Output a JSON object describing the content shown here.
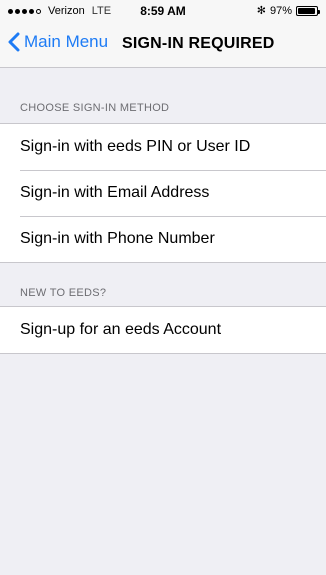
{
  "status_bar": {
    "carrier": "Verizon",
    "network": "LTE",
    "time": "8:59 AM",
    "bluetooth": "✻",
    "battery_percent": "97%",
    "battery_level": 0.97
  },
  "nav": {
    "back_label": "Main Menu",
    "title": "SIGN-IN REQUIRED"
  },
  "sections": [
    {
      "header": "CHOOSE SIGN-IN METHOD",
      "items": [
        "Sign-in with eeds PIN or User ID",
        "Sign-in with Email Address",
        "Sign-in with Phone Number"
      ]
    },
    {
      "header": "NEW TO EEDS?",
      "items": [
        "Sign-up for an eeds Account"
      ]
    }
  ],
  "colors": {
    "accent": "#1d7bf5",
    "background": "#efeff4",
    "separator": "#c8c7cc"
  }
}
